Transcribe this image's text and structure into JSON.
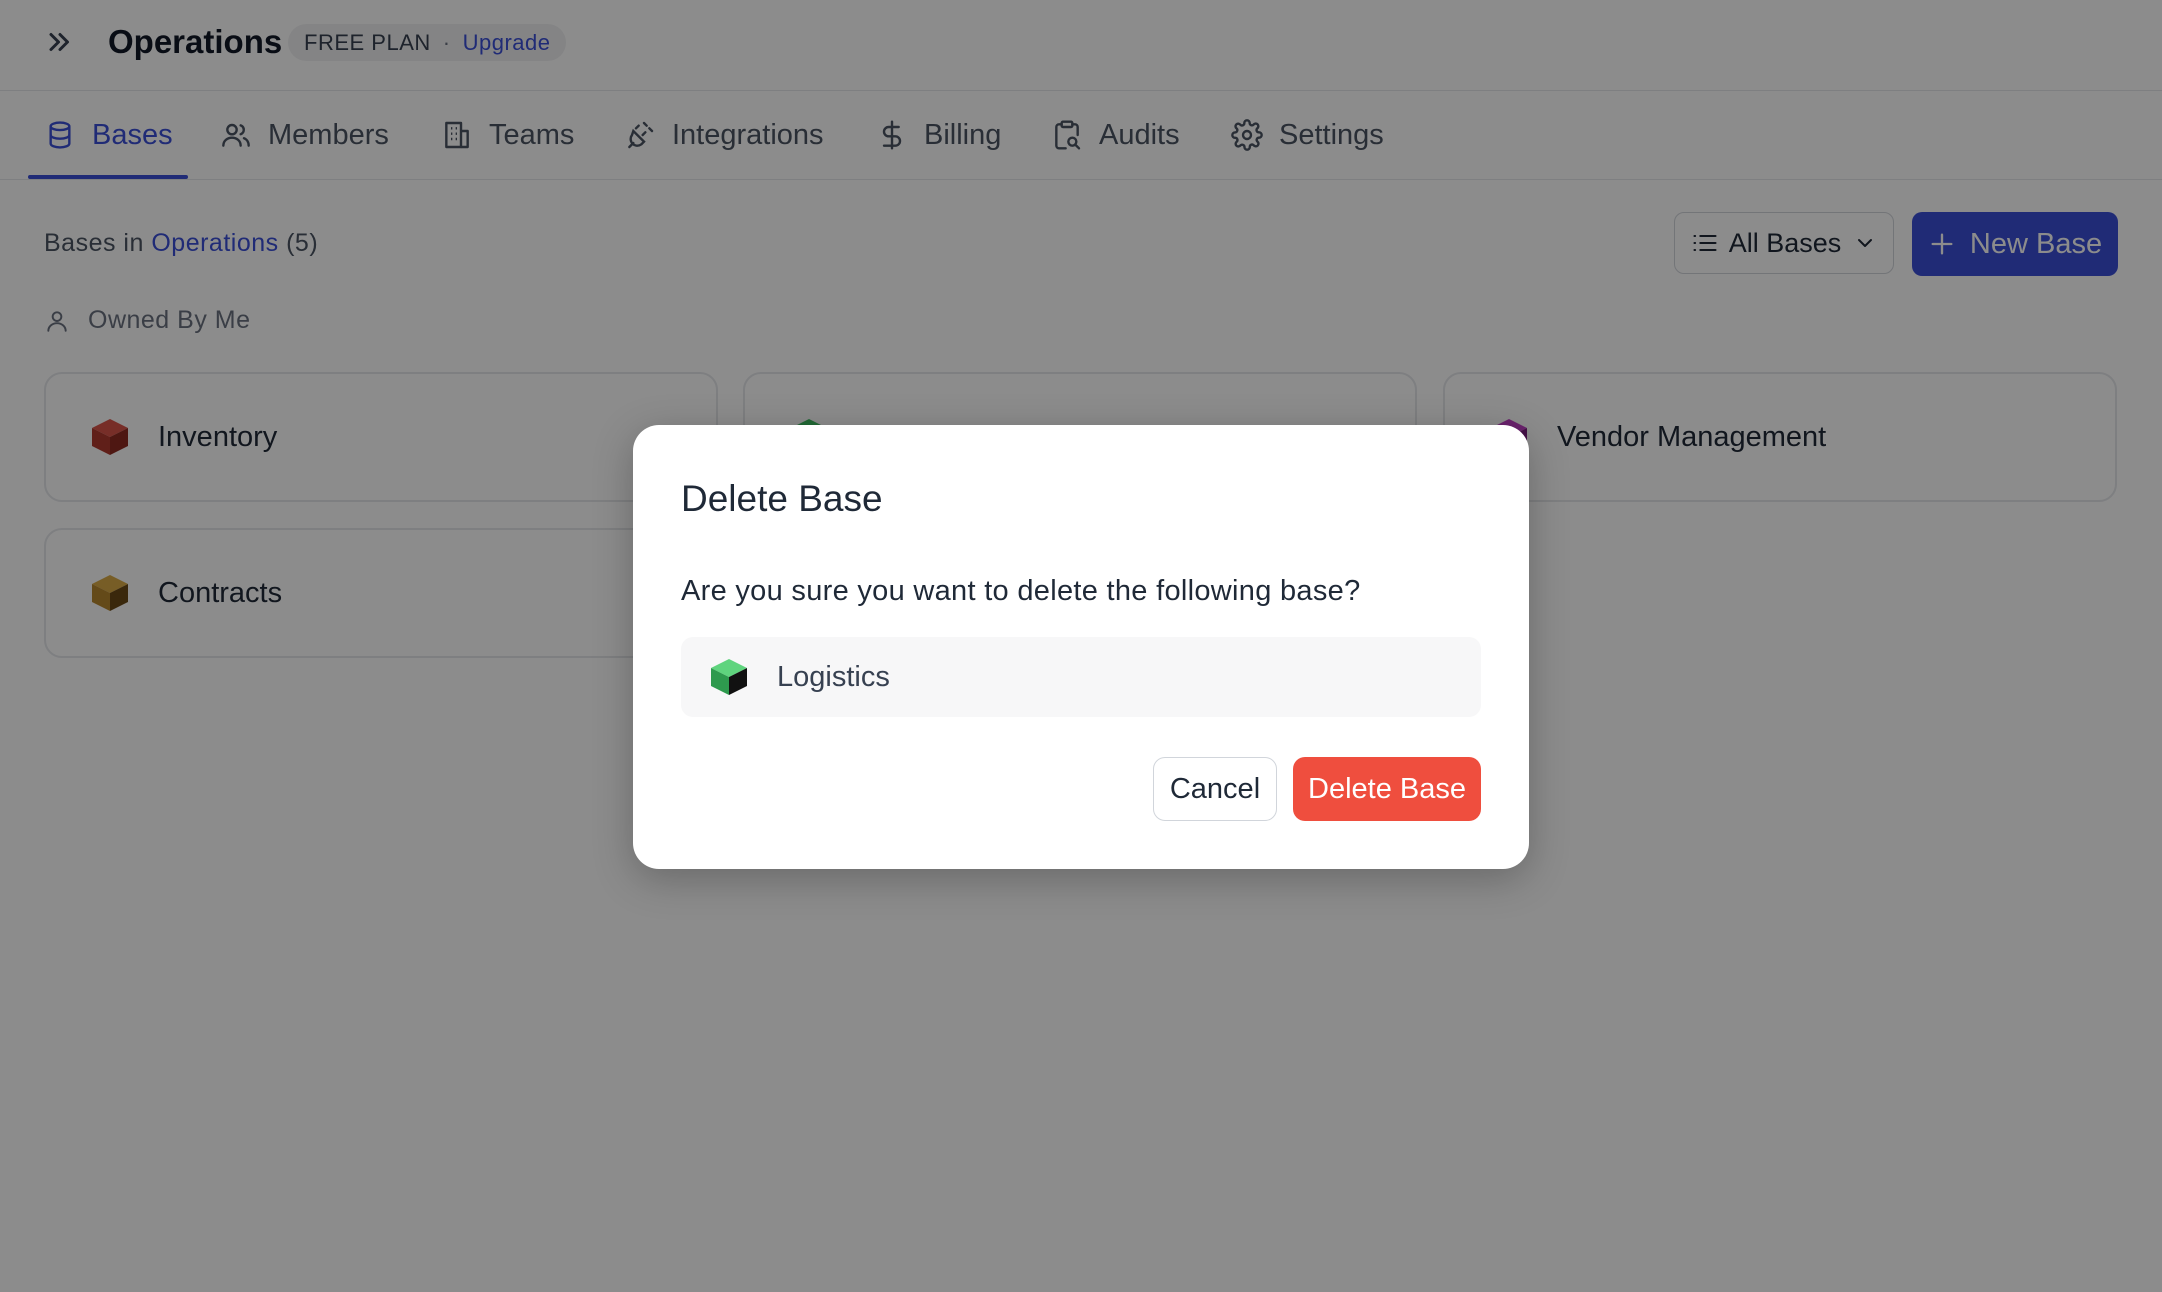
{
  "workspace": {
    "name": "Operations",
    "plan": "FREE PLAN",
    "separator": "·",
    "upgrade_label": "Upgrade"
  },
  "tabs": [
    {
      "label": "Bases",
      "icon": "database-icon",
      "active": true
    },
    {
      "label": "Members",
      "icon": "users-icon",
      "active": false
    },
    {
      "label": "Teams",
      "icon": "building-icon",
      "active": false
    },
    {
      "label": "Integrations",
      "icon": "plug-icon",
      "active": false
    },
    {
      "label": "Billing",
      "icon": "dollar-icon",
      "active": false
    },
    {
      "label": "Audits",
      "icon": "clipboard-search-icon",
      "active": false
    },
    {
      "label": "Settings",
      "icon": "gear-icon",
      "active": false
    }
  ],
  "content": {
    "heading_prefix": "Bases in",
    "heading_workspace": "Operations",
    "heading_count": "(5)",
    "filter_label": "All Bases",
    "new_base_label": "New Base",
    "owned_label": "Owned By Me",
    "cards": [
      {
        "name": "Inventory",
        "color": "#c0392b"
      },
      {
        "name": "",
        "color": "#2ecc71"
      },
      {
        "name": "Vendor Management",
        "color": "#a12aa6"
      },
      {
        "name": "Contracts",
        "color": "#b7872f"
      }
    ]
  },
  "modal": {
    "title": "Delete Base",
    "message": "Are you sure you want to delete the following base?",
    "base_name": "Logistics",
    "base_color": "#3fbf63",
    "cancel_label": "Cancel",
    "confirm_label": "Delete Base"
  },
  "colors": {
    "accent": "#3b4fd8",
    "danger": "#ef4e3e"
  }
}
